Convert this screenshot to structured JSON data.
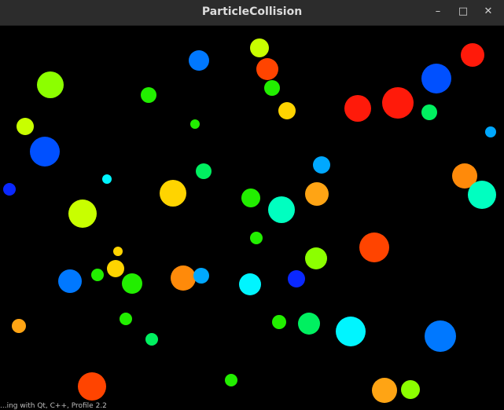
{
  "window": {
    "title": "ParticleCollision",
    "controls": {
      "minimize": "–",
      "maximize": "□",
      "close": "✕"
    }
  },
  "canvas": {
    "background": "#000000",
    "particle_colors": {
      "red": "#ff1a0a",
      "orange_red": "#ff4400",
      "orange": "#ff8a0a",
      "amber": "#ffa414",
      "yellow": "#ffd400",
      "yellow_green": "#c8ff00",
      "lime": "#8cff00",
      "green": "#22ee00",
      "spring_green": "#00f060",
      "aquamarine": "#00ffc0",
      "cyan": "#00f5ff",
      "sky": "#00a8ff",
      "azure": "#0078ff",
      "blue": "#0050ff",
      "deep_blue": "#0a28ff"
    }
  },
  "status_bar": {
    "text": "...ing with Qt, C++, Profile 2.2"
  }
}
